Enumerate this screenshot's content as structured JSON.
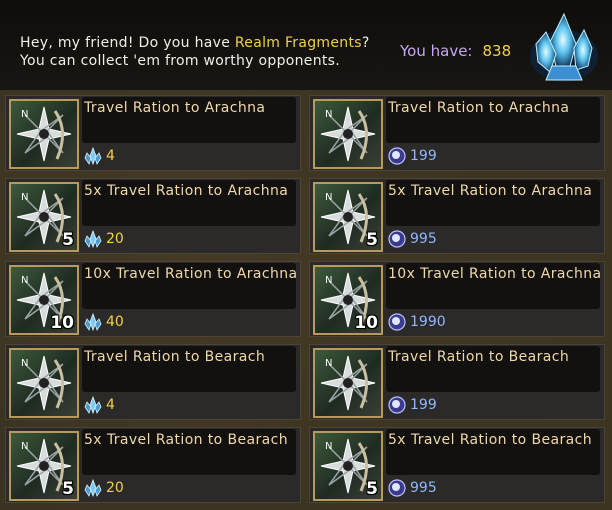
{
  "header": {
    "message_prefix": "Hey, my friend! Do you have ",
    "message_highlight": "Realm Fragments",
    "message_suffix": "?",
    "message_line2": "You can collect 'em from worthy opponents.",
    "have_label": "You have:",
    "have_value": "838",
    "icon": "realm-fragment-crystal-icon"
  },
  "colors": {
    "highlight": "#f2d14a",
    "have_label": "#c8a6f0",
    "item_name": "#f0d9a6",
    "gem_price": "#8fb8ff"
  },
  "items": [
    {
      "name": "Travel Ration to Arachna",
      "qty": "",
      "currency": "realm-fragment-icon",
      "price": "4"
    },
    {
      "name": "Travel Ration to Arachna",
      "qty": "",
      "currency": "gem-icon",
      "price": "199"
    },
    {
      "name": "5x Travel Ration to Arachna",
      "qty": "5",
      "currency": "realm-fragment-icon",
      "price": "20"
    },
    {
      "name": "5x Travel Ration to Arachna",
      "qty": "5",
      "currency": "gem-icon",
      "price": "995"
    },
    {
      "name": "10x Travel Ration to Arachna",
      "qty": "10",
      "currency": "realm-fragment-icon",
      "price": "40"
    },
    {
      "name": "10x Travel Ration to Arachna",
      "qty": "10",
      "currency": "gem-icon",
      "price": "1990"
    },
    {
      "name": "Travel Ration to Bearach",
      "qty": "",
      "currency": "realm-fragment-icon",
      "price": "4"
    },
    {
      "name": "Travel Ration to Bearach",
      "qty": "",
      "currency": "gem-icon",
      "price": "199"
    },
    {
      "name": "5x Travel Ration to Bearach",
      "qty": "5",
      "currency": "realm-fragment-icon",
      "price": "20"
    },
    {
      "name": "5x Travel Ration to Bearach",
      "qty": "5",
      "currency": "gem-icon",
      "price": "995"
    }
  ]
}
